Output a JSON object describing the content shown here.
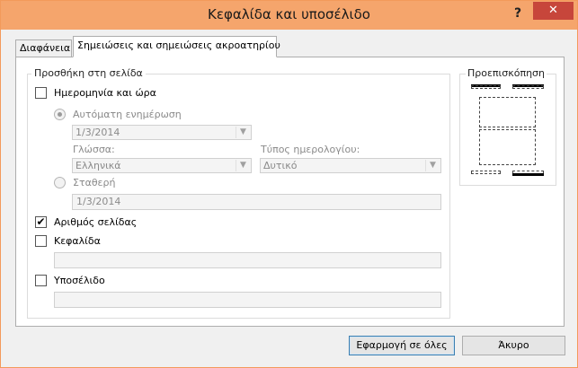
{
  "window": {
    "title": "Κεφαλίδα και υποσέλιδο",
    "help_glyph": "?",
    "close_glyph": "✕"
  },
  "tabs": [
    {
      "label": "Διαφάνεια",
      "selected": false
    },
    {
      "label": "Σημειώσεις και σημειώσεις ακροατηρίου",
      "selected": true
    }
  ],
  "include_on_page": {
    "title": "Προσθήκη στη σελίδα",
    "date_time": {
      "label": "Ημερομηνία και ώρα",
      "checked": false
    },
    "auto_update": {
      "label": "Αυτόματη ενημέρωση",
      "selected": true,
      "value": "1/3/2014"
    },
    "language": {
      "label": "Γλώσσα:",
      "value": "Ελληνικά"
    },
    "calendar": {
      "label": "Τύπος ημερολογίου:",
      "value": "Δυτικό"
    },
    "fixed": {
      "label": "Σταθερή",
      "selected": false,
      "value": "1/3/2014"
    },
    "page_number": {
      "label": "Αριθμός σελίδας",
      "checked": true
    },
    "header": {
      "label": "Κεφαλίδα",
      "checked": false,
      "value": ""
    },
    "footer": {
      "label": "Υποσέλιδο",
      "checked": false,
      "value": ""
    }
  },
  "preview": {
    "title": "Προεπισκόπηση"
  },
  "buttons": {
    "apply_all": "Εφαρμογή σε όλες",
    "cancel": "Άκυρο"
  },
  "icons": {
    "check_glyph": "✔",
    "dropdown_glyph": "▼"
  }
}
